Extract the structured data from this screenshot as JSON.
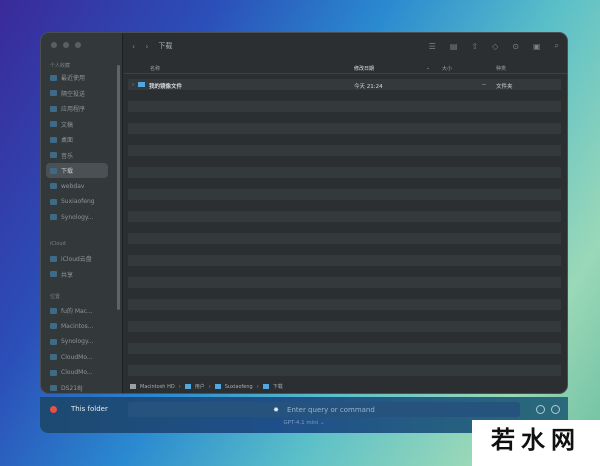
{
  "sidebar": {
    "favorites_title": "个人收藏",
    "favorites": [
      "最近使用",
      "隔空投送",
      "应用程序",
      "文稿",
      "桌面",
      "音乐",
      "下载",
      "webdav",
      "Suxiaofeng",
      "Synology..."
    ],
    "icloud_title": "iCloud",
    "icloud": [
      "iCloud云盘",
      "共享"
    ],
    "locations_title": "位置",
    "locations": [
      "fu的 Mac...",
      "Macintos...",
      "Synology...",
      "CloudMo...",
      "CloudMo...",
      "DS218J"
    ]
  },
  "toolbar": {
    "title": "下载"
  },
  "columns": {
    "name": "名称",
    "date": "修改日期",
    "size": "大小",
    "kind": "种类"
  },
  "files": [
    {
      "name": "我的镜像文件",
      "date": "今天 21:24",
      "size": "--",
      "kind": "文件夹"
    }
  ],
  "pathbar": [
    "Macintosh HD",
    "用户",
    "Suxiaofeng",
    "下载"
  ],
  "assistant": {
    "scope": "This folder",
    "placeholder": "Enter query or command",
    "model": "GPT-4.1 mini"
  },
  "watermark": "若水网",
  "colors": {
    "record": "#e8504a",
    "folder": "#4fa9e0"
  }
}
